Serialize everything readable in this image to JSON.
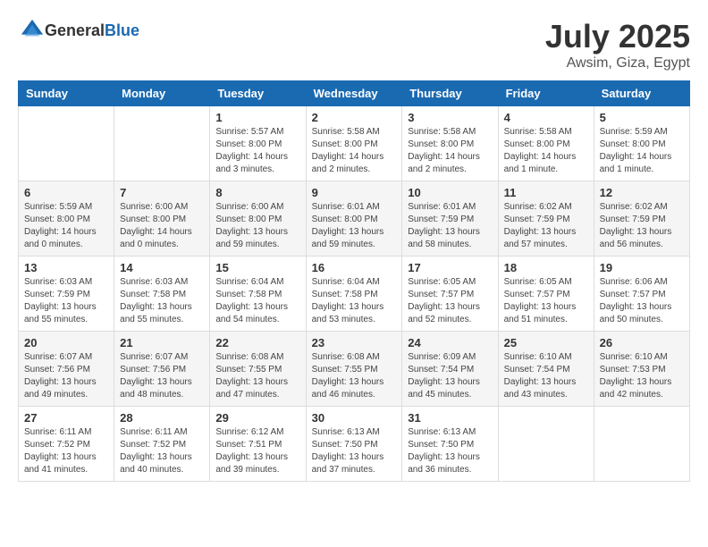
{
  "header": {
    "logo": {
      "general": "General",
      "blue": "Blue"
    },
    "month": "July 2025",
    "location": "Awsim, Giza, Egypt"
  },
  "weekdays": [
    "Sunday",
    "Monday",
    "Tuesday",
    "Wednesday",
    "Thursday",
    "Friday",
    "Saturday"
  ],
  "weeks": [
    [
      {
        "day": "",
        "info": ""
      },
      {
        "day": "",
        "info": ""
      },
      {
        "day": "1",
        "info": "Sunrise: 5:57 AM\nSunset: 8:00 PM\nDaylight: 14 hours and 3 minutes."
      },
      {
        "day": "2",
        "info": "Sunrise: 5:58 AM\nSunset: 8:00 PM\nDaylight: 14 hours and 2 minutes."
      },
      {
        "day": "3",
        "info": "Sunrise: 5:58 AM\nSunset: 8:00 PM\nDaylight: 14 hours and 2 minutes."
      },
      {
        "day": "4",
        "info": "Sunrise: 5:58 AM\nSunset: 8:00 PM\nDaylight: 14 hours and 1 minute."
      },
      {
        "day": "5",
        "info": "Sunrise: 5:59 AM\nSunset: 8:00 PM\nDaylight: 14 hours and 1 minute."
      }
    ],
    [
      {
        "day": "6",
        "info": "Sunrise: 5:59 AM\nSunset: 8:00 PM\nDaylight: 14 hours and 0 minutes."
      },
      {
        "day": "7",
        "info": "Sunrise: 6:00 AM\nSunset: 8:00 PM\nDaylight: 14 hours and 0 minutes."
      },
      {
        "day": "8",
        "info": "Sunrise: 6:00 AM\nSunset: 8:00 PM\nDaylight: 13 hours and 59 minutes."
      },
      {
        "day": "9",
        "info": "Sunrise: 6:01 AM\nSunset: 8:00 PM\nDaylight: 13 hours and 59 minutes."
      },
      {
        "day": "10",
        "info": "Sunrise: 6:01 AM\nSunset: 7:59 PM\nDaylight: 13 hours and 58 minutes."
      },
      {
        "day": "11",
        "info": "Sunrise: 6:02 AM\nSunset: 7:59 PM\nDaylight: 13 hours and 57 minutes."
      },
      {
        "day": "12",
        "info": "Sunrise: 6:02 AM\nSunset: 7:59 PM\nDaylight: 13 hours and 56 minutes."
      }
    ],
    [
      {
        "day": "13",
        "info": "Sunrise: 6:03 AM\nSunset: 7:59 PM\nDaylight: 13 hours and 55 minutes."
      },
      {
        "day": "14",
        "info": "Sunrise: 6:03 AM\nSunset: 7:58 PM\nDaylight: 13 hours and 55 minutes."
      },
      {
        "day": "15",
        "info": "Sunrise: 6:04 AM\nSunset: 7:58 PM\nDaylight: 13 hours and 54 minutes."
      },
      {
        "day": "16",
        "info": "Sunrise: 6:04 AM\nSunset: 7:58 PM\nDaylight: 13 hours and 53 minutes."
      },
      {
        "day": "17",
        "info": "Sunrise: 6:05 AM\nSunset: 7:57 PM\nDaylight: 13 hours and 52 minutes."
      },
      {
        "day": "18",
        "info": "Sunrise: 6:05 AM\nSunset: 7:57 PM\nDaylight: 13 hours and 51 minutes."
      },
      {
        "day": "19",
        "info": "Sunrise: 6:06 AM\nSunset: 7:57 PM\nDaylight: 13 hours and 50 minutes."
      }
    ],
    [
      {
        "day": "20",
        "info": "Sunrise: 6:07 AM\nSunset: 7:56 PM\nDaylight: 13 hours and 49 minutes."
      },
      {
        "day": "21",
        "info": "Sunrise: 6:07 AM\nSunset: 7:56 PM\nDaylight: 13 hours and 48 minutes."
      },
      {
        "day": "22",
        "info": "Sunrise: 6:08 AM\nSunset: 7:55 PM\nDaylight: 13 hours and 47 minutes."
      },
      {
        "day": "23",
        "info": "Sunrise: 6:08 AM\nSunset: 7:55 PM\nDaylight: 13 hours and 46 minutes."
      },
      {
        "day": "24",
        "info": "Sunrise: 6:09 AM\nSunset: 7:54 PM\nDaylight: 13 hours and 45 minutes."
      },
      {
        "day": "25",
        "info": "Sunrise: 6:10 AM\nSunset: 7:54 PM\nDaylight: 13 hours and 43 minutes."
      },
      {
        "day": "26",
        "info": "Sunrise: 6:10 AM\nSunset: 7:53 PM\nDaylight: 13 hours and 42 minutes."
      }
    ],
    [
      {
        "day": "27",
        "info": "Sunrise: 6:11 AM\nSunset: 7:52 PM\nDaylight: 13 hours and 41 minutes."
      },
      {
        "day": "28",
        "info": "Sunrise: 6:11 AM\nSunset: 7:52 PM\nDaylight: 13 hours and 40 minutes."
      },
      {
        "day": "29",
        "info": "Sunrise: 6:12 AM\nSunset: 7:51 PM\nDaylight: 13 hours and 39 minutes."
      },
      {
        "day": "30",
        "info": "Sunrise: 6:13 AM\nSunset: 7:50 PM\nDaylight: 13 hours and 37 minutes."
      },
      {
        "day": "31",
        "info": "Sunrise: 6:13 AM\nSunset: 7:50 PM\nDaylight: 13 hours and 36 minutes."
      },
      {
        "day": "",
        "info": ""
      },
      {
        "day": "",
        "info": ""
      }
    ]
  ]
}
